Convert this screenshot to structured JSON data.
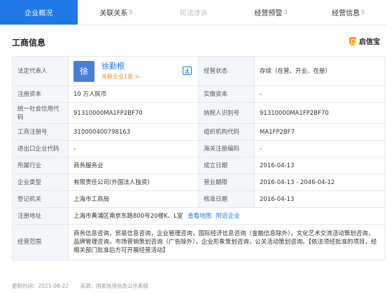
{
  "tabs": [
    {
      "label": "企业概况",
      "count": "",
      "state": "active"
    },
    {
      "label": "关联关系",
      "count": "5",
      "state": "normal"
    },
    {
      "label": "司法涉诉",
      "count": "",
      "state": "disabled"
    },
    {
      "label": "经营预警",
      "count": "3",
      "state": "normal"
    },
    {
      "label": "经营信息",
      "count": "5",
      "state": "normal"
    }
  ],
  "section": {
    "title": "工商信息",
    "brand": "启信宝"
  },
  "rep": {
    "label": "法定代表人",
    "avatar_char": "徐",
    "name": "徐勤根",
    "related": "关联企业1家 >",
    "status_label": "经营状态",
    "status_value": "存续（在营、开业、在册）"
  },
  "rows": [
    {
      "l1": "注册资本",
      "v1": "10 万人民币",
      "l2": "实缴资本",
      "v2": "-"
    },
    {
      "l1": "统一社会信用代码",
      "v1": "91310000MA1FP2BF70",
      "l2": "纳税人识别号",
      "v2": "91310000MA1FP2BF70"
    },
    {
      "l1": "工商注册号",
      "v1": "310000400798163",
      "l2": "组织机构代码",
      "v2": "MA1FP2BF7"
    },
    {
      "l1": "进出口企业代码",
      "v1": "-",
      "l2": "海关注册编码",
      "v2": "-"
    },
    {
      "l1": "所属行业",
      "v1": "商务服务业",
      "l2": "成立日期",
      "v2": "2016-04-13"
    },
    {
      "l1": "企业类型",
      "v1": "有限责任公司(外国法人独资)",
      "l2": "营业期限",
      "v2": "2016-04-13 - 2046-04-12"
    },
    {
      "l1": "登记机关",
      "v1": "上海市工商局",
      "l2": "核准日期",
      "v2": "2016-04-13"
    }
  ],
  "address": {
    "label": "注册地址",
    "value": "上海市黄浦区南京东路800号20楼K、L室",
    "map_link": "查看地图",
    "nearby_link": "附近企业"
  },
  "scope": {
    "label": "经营范围",
    "value": "商务信息咨询，贸易信息咨询，企业管理咨询，国际经济信息咨询（金融信息除外），文化艺术交流活动策划咨询，品牌管理咨询，市场营销策划咨询（广告除外），企业形象策划咨询，公关活动策划咨询。【依法须经批准的项目，经相关部门批准后方可开展经营活动】"
  },
  "footer": {
    "updated": "更新时间：2021-08-22",
    "source": "来源：国家信用信息公示系统"
  },
  "colors": {
    "accent": "#1e78e6",
    "label_bg": "#f3f7fc",
    "related": "#f08c1e",
    "brand_logo": "#f0a020"
  }
}
